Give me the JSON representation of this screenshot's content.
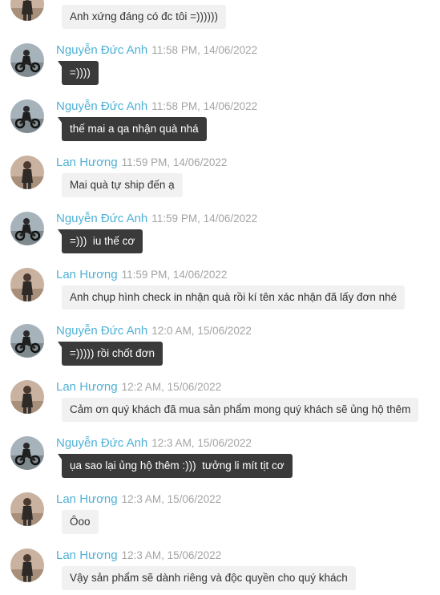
{
  "messages": [
    {
      "sender": "",
      "time": "",
      "text": "Anh xứng đáng có đc tôi =))))))",
      "avatar": "woman-avatar",
      "style": "light"
    },
    {
      "sender": "Nguyễn Đức Anh",
      "time": "11:58 PM, 14/06/2022",
      "text": "=))))",
      "avatar": "man-motorbike-avatar",
      "style": "dark"
    },
    {
      "sender": "Nguyễn Đức Anh",
      "time": "11:58 PM, 14/06/2022",
      "text": "thế mai a qa nhận quà nhá",
      "avatar": "man-motorbike-avatar",
      "style": "dark"
    },
    {
      "sender": "Lan Hương",
      "time": "11:59 PM, 14/06/2022",
      "text": "Mai quà tự ship đến ạ",
      "avatar": "woman-avatar",
      "style": "light"
    },
    {
      "sender": "Nguyễn Đức Anh",
      "time": "11:59 PM, 14/06/2022",
      "text": "=)))  iu thế cơ",
      "avatar": "man-motorbike-avatar",
      "style": "dark"
    },
    {
      "sender": "Lan Hương",
      "time": "11:59 PM, 14/06/2022",
      "text": "Anh chụp hình check in nhận quà rồi kí tên xác nhận đã lấy đơn nhé",
      "avatar": "woman-avatar",
      "style": "light"
    },
    {
      "sender": "Nguyễn Đức Anh",
      "time": "12:0 AM, 15/06/2022",
      "text": "=))))) rồi chốt đơn",
      "avatar": "man-motorbike-avatar",
      "style": "dark"
    },
    {
      "sender": "Lan Hương",
      "time": "12:2 AM, 15/06/2022",
      "text": "Cảm ơn quý khách đã mua sản phẩm mong quý khách sẽ ủng hộ thêm",
      "avatar": "woman-avatar",
      "style": "light"
    },
    {
      "sender": "Nguyễn Đức Anh",
      "time": "12:3 AM, 15/06/2022",
      "text": "ụa sao lại ủng hộ thêm :)))  tưởng li mít tịt cơ",
      "avatar": "man-motorbike-avatar",
      "style": "dark"
    },
    {
      "sender": "Lan Hương",
      "time": "12:3 AM, 15/06/2022",
      "text": "Ôoo",
      "avatar": "woman-avatar",
      "style": "light"
    },
    {
      "sender": "Lan Hương",
      "time": "12:3 AM, 15/06/2022",
      "text": "Vậy sản phẩm sẽ dành riêng và độc quyền cho quý khách",
      "avatar": "woman-avatar",
      "style": "light"
    }
  ]
}
